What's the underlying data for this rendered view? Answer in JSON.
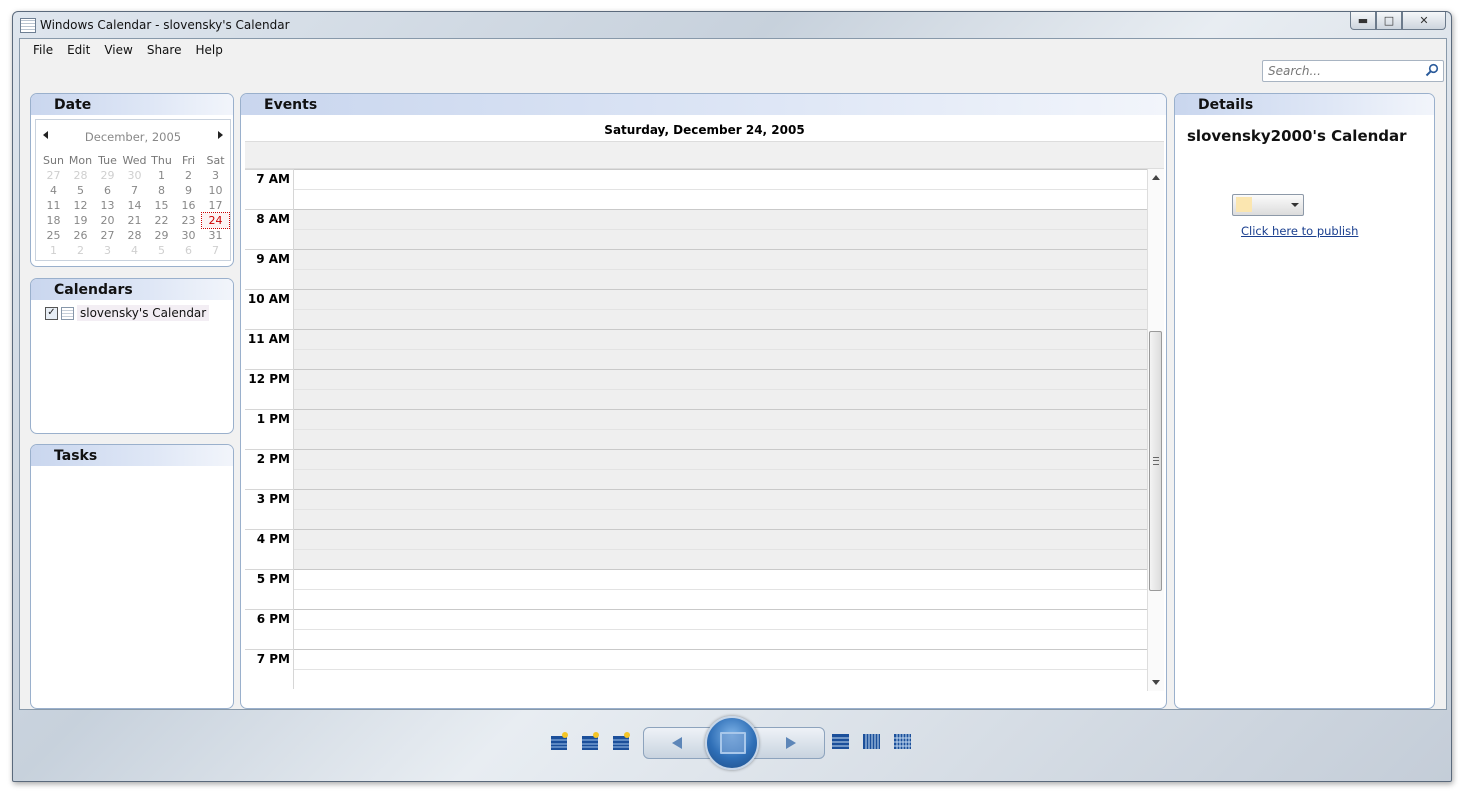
{
  "window": {
    "title": "Windows Calendar - slovensky's Calendar"
  },
  "menu": [
    "File",
    "Edit",
    "View",
    "Share",
    "Help"
  ],
  "search": {
    "placeholder": "Search..."
  },
  "date_panel": {
    "title": "Date",
    "month_label": "December, 2005",
    "weekdays": [
      "Sun",
      "Mon",
      "Tue",
      "Wed",
      "Thu",
      "Fri",
      "Sat"
    ],
    "weeks": [
      [
        "27",
        "28",
        "29",
        "30",
        "1",
        "2",
        "3"
      ],
      [
        "4",
        "5",
        "6",
        "7",
        "8",
        "9",
        "10"
      ],
      [
        "11",
        "12",
        "13",
        "14",
        "15",
        "16",
        "17"
      ],
      [
        "18",
        "19",
        "20",
        "21",
        "22",
        "23",
        "24"
      ],
      [
        "25",
        "26",
        "27",
        "28",
        "29",
        "30",
        "31"
      ],
      [
        "1",
        "2",
        "3",
        "4",
        "5",
        "6",
        "7"
      ]
    ],
    "selected_day": "24"
  },
  "calendars_panel": {
    "title": "Calendars",
    "items": [
      {
        "label": "slovensky's Calendar",
        "checked": true
      }
    ]
  },
  "tasks_panel": {
    "title": "Tasks"
  },
  "events_panel": {
    "title": "Events",
    "date_heading": "Saturday, December 24, 2005",
    "hours": [
      "7 AM",
      "8 AM",
      "9 AM",
      "10 AM",
      "11 AM",
      "12 PM",
      "1 PM",
      "2 PM",
      "3 PM",
      "4 PM",
      "5 PM",
      "6 PM",
      "7 PM"
    ],
    "work_hours_shaded": [
      "8 AM",
      "9 AM",
      "10 AM",
      "11 AM",
      "12 PM",
      "1 PM",
      "2 PM",
      "3 PM",
      "4 PM"
    ]
  },
  "details_panel": {
    "title": "Details",
    "calendar_name": "slovensky2000's Calendar",
    "color": "#fbe6b0",
    "publish_link": "Click here to publish"
  },
  "toolbar": {
    "icons": [
      "new-appointment-icon",
      "new-task-icon",
      "new-calendar-icon",
      "day-view-icon",
      "week-view-icon",
      "month-view-icon"
    ]
  },
  "colors": {
    "panel_header": "#c9d6ee",
    "today_outline": "#cc0000",
    "link": "#1a3f8f"
  }
}
